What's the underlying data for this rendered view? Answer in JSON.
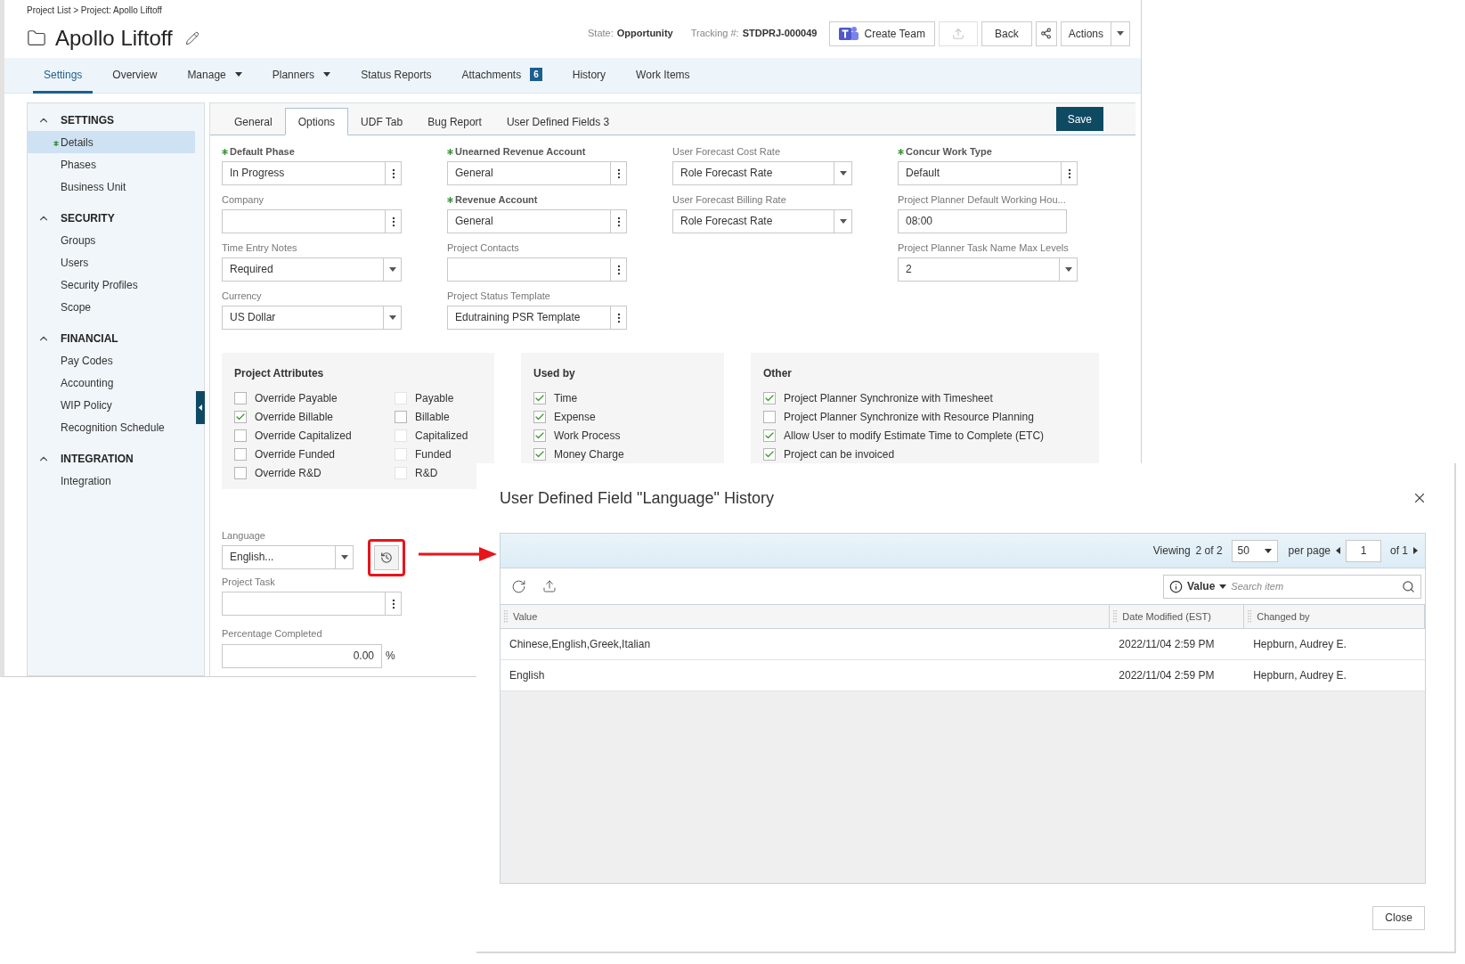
{
  "breadcrumb": "Project List > Project: Apollo Liftoff",
  "title": "Apollo Liftoff",
  "state": {
    "label": "State:",
    "value": "Opportunity"
  },
  "tracking": {
    "label": "Tracking #:",
    "value": "STDPRJ-000049"
  },
  "header_buttons": {
    "create_team": "Create Team",
    "back": "Back",
    "actions": "Actions"
  },
  "nav_tabs": [
    {
      "label": "Settings",
      "selected": true,
      "dropdown": false
    },
    {
      "label": "Overview",
      "selected": false,
      "dropdown": false
    },
    {
      "label": "Manage",
      "selected": false,
      "dropdown": true
    },
    {
      "label": "Planners",
      "selected": false,
      "dropdown": true
    },
    {
      "label": "Status Reports",
      "selected": false,
      "dropdown": false
    },
    {
      "label": "Attachments",
      "selected": false,
      "dropdown": false,
      "badge": "6"
    },
    {
      "label": "History",
      "selected": false,
      "dropdown": false
    },
    {
      "label": "Work Items",
      "selected": false,
      "dropdown": false
    }
  ],
  "sidebar": [
    {
      "heading": "SETTINGS",
      "expanded": true,
      "items": [
        {
          "label": "Details",
          "selected": true,
          "modified": true
        },
        {
          "label": "Phases",
          "selected": false,
          "modified": false
        },
        {
          "label": "Business Unit",
          "selected": false,
          "modified": false
        }
      ]
    },
    {
      "heading": "SECURITY",
      "expanded": true,
      "items": [
        {
          "label": "Groups",
          "selected": false,
          "modified": false
        },
        {
          "label": "Users",
          "selected": false,
          "modified": false
        },
        {
          "label": "Security Profiles",
          "selected": false,
          "modified": false
        },
        {
          "label": "Scope",
          "selected": false,
          "modified": false
        }
      ]
    },
    {
      "heading": "FINANCIAL",
      "expanded": true,
      "items": [
        {
          "label": "Pay Codes",
          "selected": false,
          "modified": false
        },
        {
          "label": "Accounting",
          "selected": false,
          "modified": false
        },
        {
          "label": "WIP Policy",
          "selected": false,
          "modified": false
        },
        {
          "label": "Recognition Schedule",
          "selected": false,
          "modified": false
        }
      ]
    },
    {
      "heading": "INTEGRATION",
      "expanded": true,
      "items": [
        {
          "label": "Integration",
          "selected": false,
          "modified": false
        }
      ]
    }
  ],
  "subtabs": [
    {
      "label": "General",
      "selected": false
    },
    {
      "label": "Options",
      "selected": true
    },
    {
      "label": "UDF Tab",
      "selected": false
    },
    {
      "label": "Bug Report",
      "selected": false
    },
    {
      "label": "User Defined Fields 3",
      "selected": false
    }
  ],
  "save": "Save",
  "field_columns": [
    [
      {
        "label": "Default Phase",
        "required": true,
        "kind": "menu",
        "value": "In Progress"
      },
      {
        "label": "Company",
        "required": false,
        "kind": "menu"
      },
      {
        "label": "Time Entry Notes",
        "required": false,
        "kind": "select",
        "value": "Required"
      },
      {
        "label": "Currency",
        "required": false,
        "kind": "select",
        "value": "US Dollar"
      }
    ],
    [
      {
        "label": "Unearned Revenue Account",
        "required": true,
        "kind": "menu",
        "value": "General"
      },
      {
        "label": "Revenue Account",
        "required": true,
        "kind": "menu",
        "value": "General"
      },
      {
        "label": "Project Contacts",
        "required": false,
        "kind": "menu"
      },
      {
        "label": "Project Status Template",
        "required": false,
        "kind": "menu",
        "value": "Edutraining PSR Template"
      }
    ],
    [
      {
        "label": "User Forecast Cost Rate",
        "required": false,
        "kind": "select",
        "value": "Role Forecast Rate"
      },
      {
        "label": "User Forecast Billing Rate",
        "required": false,
        "kind": "select",
        "value": "Role Forecast Rate"
      }
    ],
    [
      {
        "label": "Concur Work Type",
        "required": true,
        "kind": "menu",
        "value": "Default"
      },
      {
        "label": "Project Planner Default Working Hou...",
        "required": false,
        "kind": "text",
        "value": "08:00"
      },
      {
        "label": "Project Planner Task Name Max Levels",
        "required": false,
        "kind": "select",
        "value": "2"
      }
    ]
  ],
  "groups": [
    {
      "title": "Project Attributes",
      "kind": "two-column",
      "items": [
        {
          "label": "Override Payable",
          "checked": false,
          "disabled": false
        },
        {
          "label": "Payable",
          "checked": false,
          "disabled": true
        },
        {
          "label": "Override Billable",
          "checked": true,
          "disabled": false
        },
        {
          "label": "Billable",
          "checked": false,
          "disabled": false
        },
        {
          "label": "Override Capitalized",
          "checked": false,
          "disabled": false
        },
        {
          "label": "Capitalized",
          "checked": false,
          "disabled": true
        },
        {
          "label": "Override Funded",
          "checked": false,
          "disabled": false
        },
        {
          "label": "Funded",
          "checked": false,
          "disabled": true
        },
        {
          "label": "Override R&D",
          "checked": false,
          "disabled": false
        },
        {
          "label": "R&D",
          "checked": false,
          "disabled": true
        }
      ]
    },
    {
      "title": "Used by",
      "kind": "list",
      "items": [
        {
          "label": "Time",
          "checked": true,
          "disabled": false
        },
        {
          "label": "Expense",
          "checked": true,
          "disabled": false
        },
        {
          "label": "Work Process",
          "checked": true,
          "disabled": false
        },
        {
          "label": "Money Charge",
          "checked": true,
          "disabled": false
        }
      ]
    },
    {
      "title": "Other",
      "kind": "list",
      "items": [
        {
          "label": "Project Planner Synchronize with Timesheet",
          "checked": true,
          "disabled": false
        },
        {
          "label": "Project Planner Synchronize with Resource Planning",
          "checked": false,
          "disabled": false
        },
        {
          "label": "Allow User to modify Estimate Time to Complete (ETC)",
          "checked": true,
          "disabled": false
        },
        {
          "label": "Project can be invoiced",
          "checked": true,
          "disabled": false
        }
      ]
    }
  ],
  "language": {
    "label": "Language",
    "value": "English..."
  },
  "project_task": {
    "label": "Project Task"
  },
  "percentage": {
    "label": "Percentage Completed",
    "value": "0.00",
    "unit": "%"
  },
  "dialog": {
    "title": "User Defined Field \"Language\" History",
    "viewing_label": "Viewing",
    "viewing_count": "2 of 2",
    "per_page_value": "50",
    "per_page_label": "per page",
    "page": "1",
    "page_of": "of 1",
    "search_filter": "Value",
    "search_placeholder": "Search item",
    "columns": [
      "Value",
      "Date Modified (EST)",
      "Changed by"
    ],
    "rows": [
      [
        "Chinese,English,Greek,Italian",
        "2022/11/04 2:59 PM",
        "Hepburn, Audrey E."
      ],
      [
        "English",
        "2022/11/04 2:59 PM",
        "Hepburn, Audrey E."
      ]
    ],
    "close": "Close"
  }
}
